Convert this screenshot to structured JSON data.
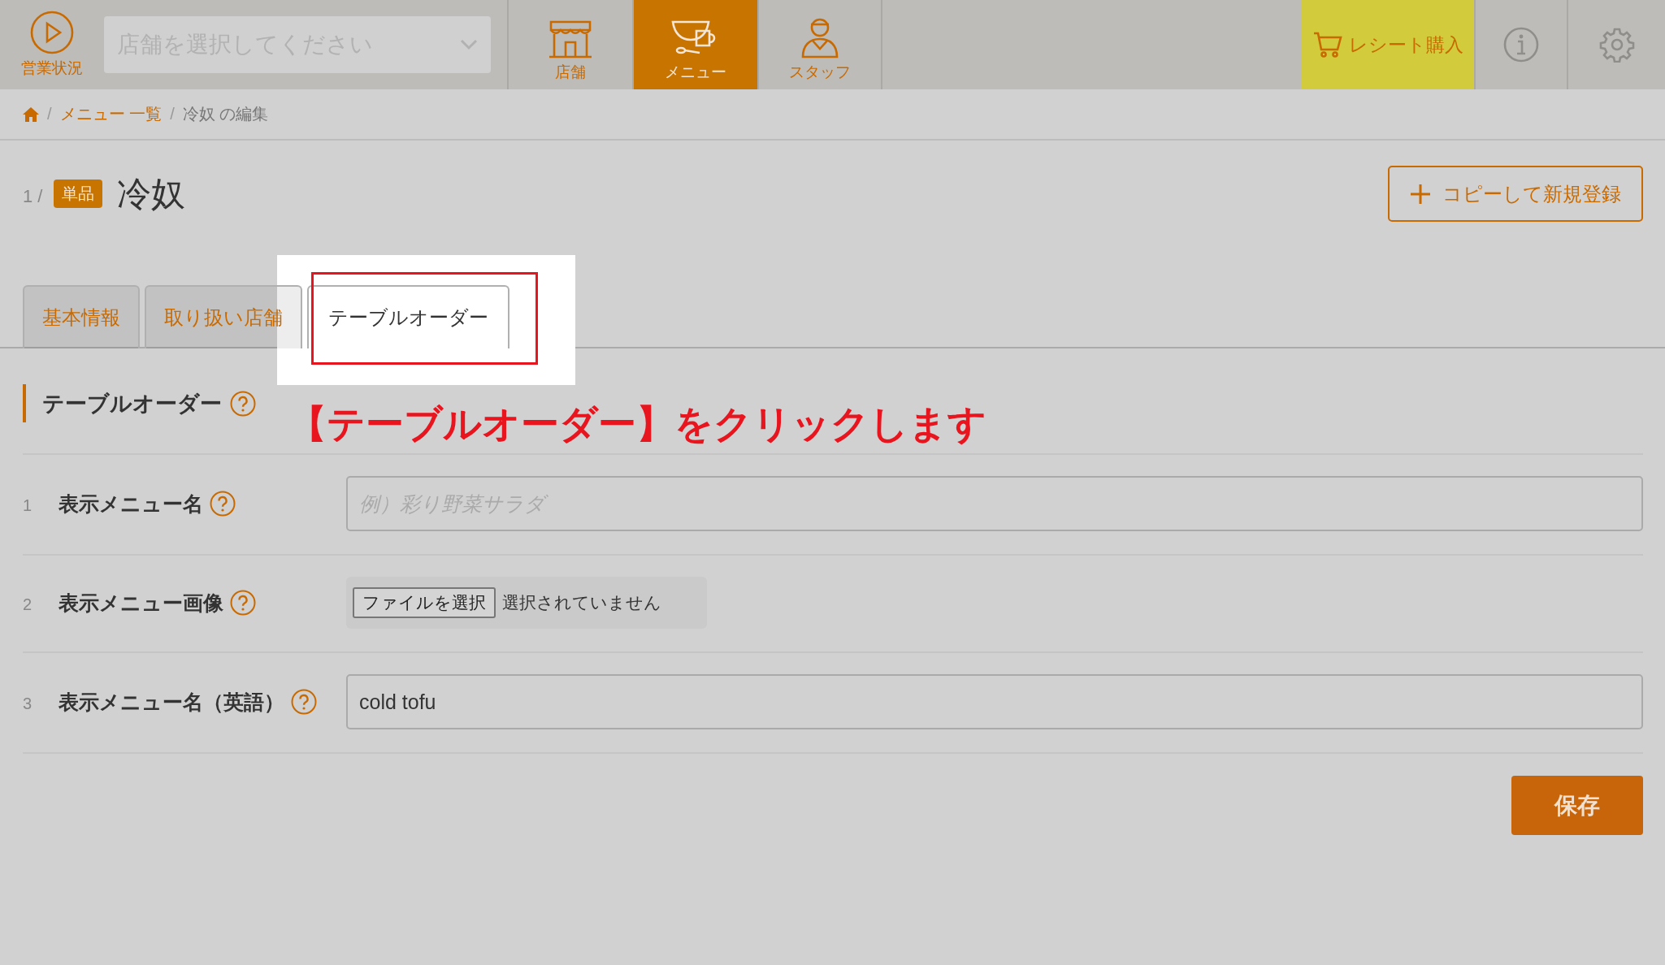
{
  "header": {
    "status_button": {
      "label": "営業状況"
    },
    "store_select": {
      "placeholder": "店舗を選択してください"
    },
    "nav": [
      {
        "label": "店舗",
        "selected": false
      },
      {
        "label": "メニュー",
        "selected": true
      },
      {
        "label": "スタッフ",
        "selected": false
      }
    ],
    "receipt_button": {
      "label": "レシート購入"
    }
  },
  "breadcrumb": {
    "separator": "/",
    "items": [
      {
        "label": "メニュー 一覧",
        "kind": "link"
      },
      {
        "label": "冷奴 の編集",
        "kind": "current"
      }
    ]
  },
  "title": {
    "index": "1 /",
    "badge": "単品",
    "name": "冷奴"
  },
  "copy_button": {
    "label": "コピーして新規登録"
  },
  "tabs": [
    {
      "label": "基本情報",
      "selected": false
    },
    {
      "label": "取り扱い店舗",
      "selected": false
    },
    {
      "label": "テーブルオーダー",
      "selected": true
    }
  ],
  "section": {
    "title": "テーブルオーダー"
  },
  "annotation": {
    "text": "【テーブルオーダー】をクリックします"
  },
  "fields": [
    {
      "number": "1",
      "label": "表示メニュー名",
      "kind": "text",
      "placeholder": "例）彩り野菜サラダ"
    },
    {
      "number": "2",
      "label": "表示メニュー画像",
      "kind": "file",
      "button": "ファイルを選択",
      "status": "選択されていません"
    },
    {
      "number": "3",
      "label": "表示メニュー名（英語）",
      "kind": "text",
      "value": "cold tofu"
    }
  ],
  "save_button": {
    "label": "保存"
  }
}
